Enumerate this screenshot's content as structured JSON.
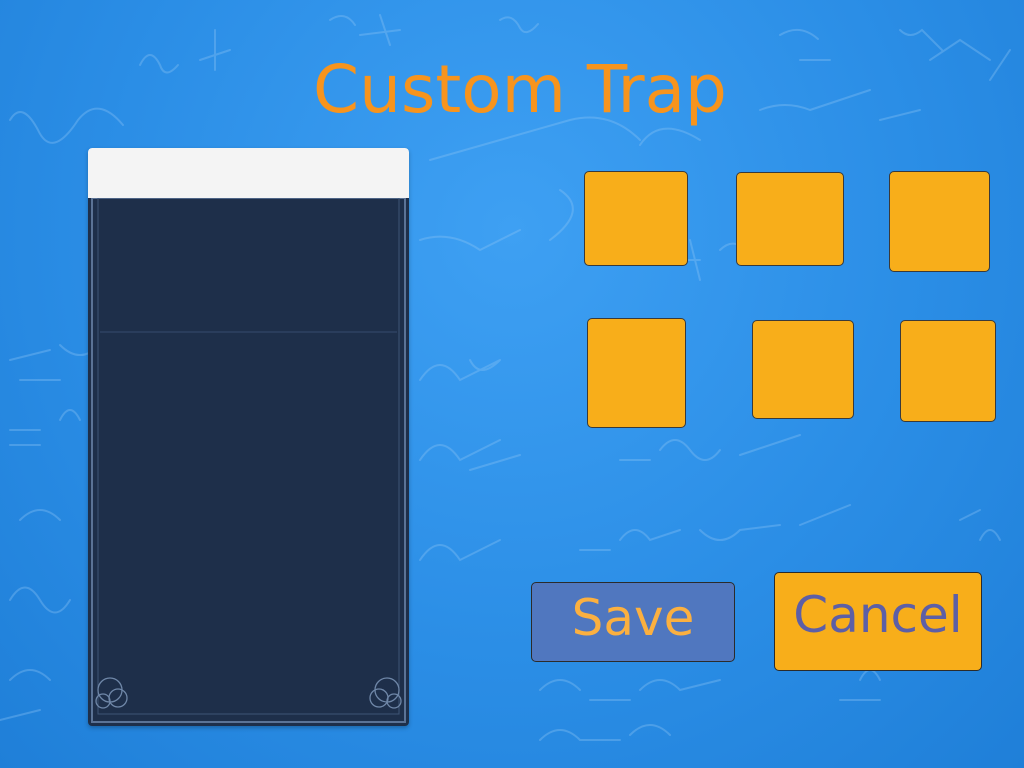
{
  "title": "Custom Trap",
  "buttons": {
    "save_label": "Save",
    "cancel_label": "Cancel"
  },
  "trap_slots": [
    {
      "id": "slot-1"
    },
    {
      "id": "slot-2"
    },
    {
      "id": "slot-3"
    },
    {
      "id": "slot-4"
    },
    {
      "id": "slot-5"
    },
    {
      "id": "slot-6"
    }
  ],
  "colors": {
    "background": "#2f8de4",
    "title": "#f7941d",
    "slot": "#f8ae1a",
    "panel_body": "#1e2f4a",
    "panel_header": "#f4f4f4",
    "save_button": "#5077bf",
    "save_text": "#fbb040",
    "cancel_button": "#f8ae1a",
    "cancel_text": "#5d5fa6"
  }
}
